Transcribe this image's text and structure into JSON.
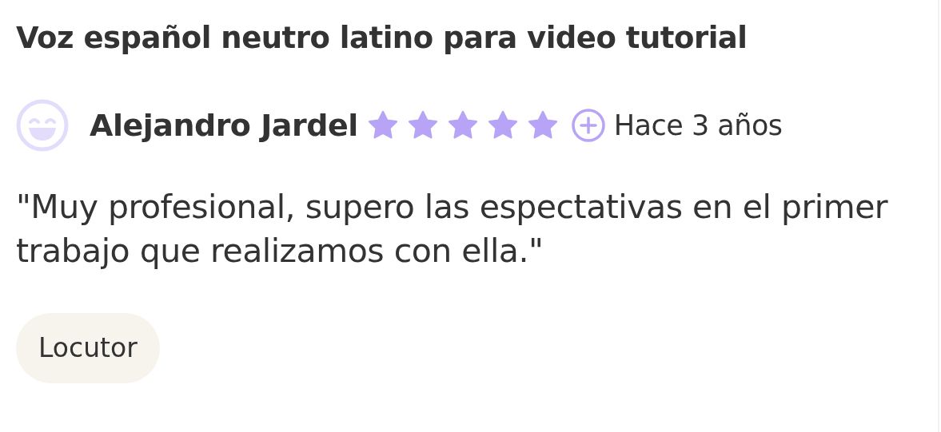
{
  "title": "Voz español neutro latino para video tutorial",
  "review": {
    "author": "Alejandro Jardel",
    "stars": 5,
    "time": "Hace 3 años",
    "quote": "\"Muy profesional, supero las espectativas en el primer trabajo que realizamos con ella.\""
  },
  "tags": [
    "Locutor"
  ]
}
